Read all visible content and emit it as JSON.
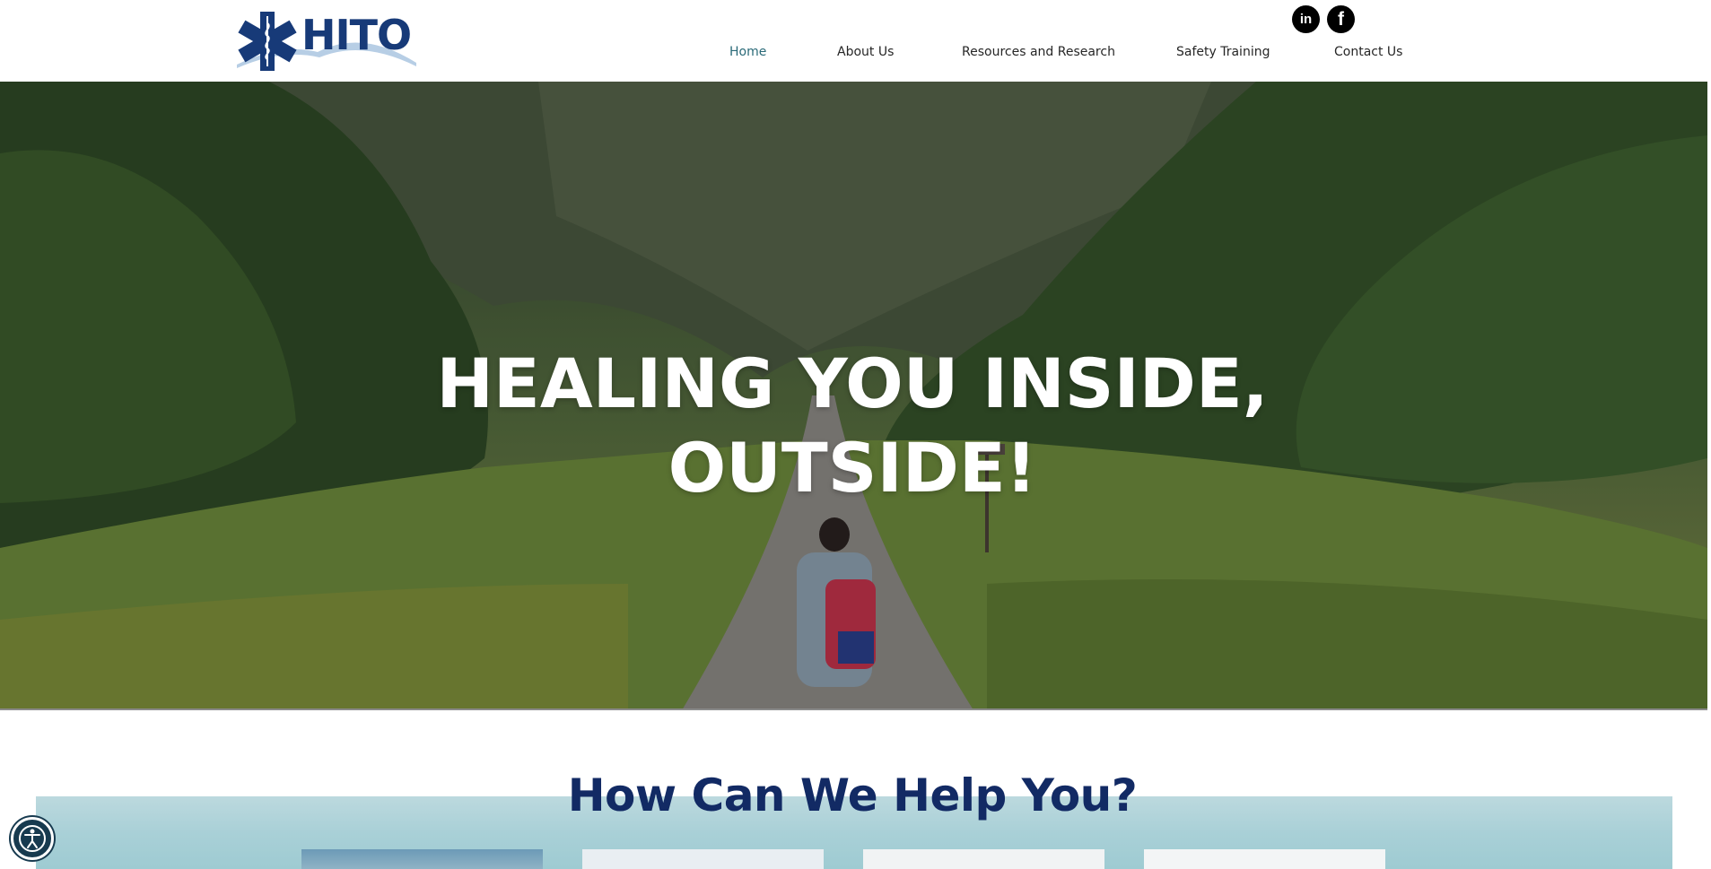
{
  "header": {
    "logo_text": "HITO",
    "social": {
      "linkedin_label": "in",
      "facebook_label": "f"
    },
    "nav": [
      {
        "label": "Home",
        "active": true
      },
      {
        "label": "About Us",
        "active": false
      },
      {
        "label": "Resources and Research",
        "active": false
      },
      {
        "label": "Safety Training",
        "active": false
      },
      {
        "label": "Contact Us",
        "active": false
      }
    ]
  },
  "hero": {
    "title_line1": "HEALING YOU INSIDE,",
    "title_line2": "OUTSIDE!"
  },
  "help": {
    "title": "How Can We Help You?"
  },
  "colors": {
    "brand_navy": "#122a64",
    "nav_active": "#2a6a78",
    "nav_text": "#262626"
  },
  "icons": {
    "logo": "star-of-life-icon",
    "linkedin": "linkedin-icon",
    "facebook": "facebook-icon",
    "accessibility": "accessibility-icon"
  }
}
